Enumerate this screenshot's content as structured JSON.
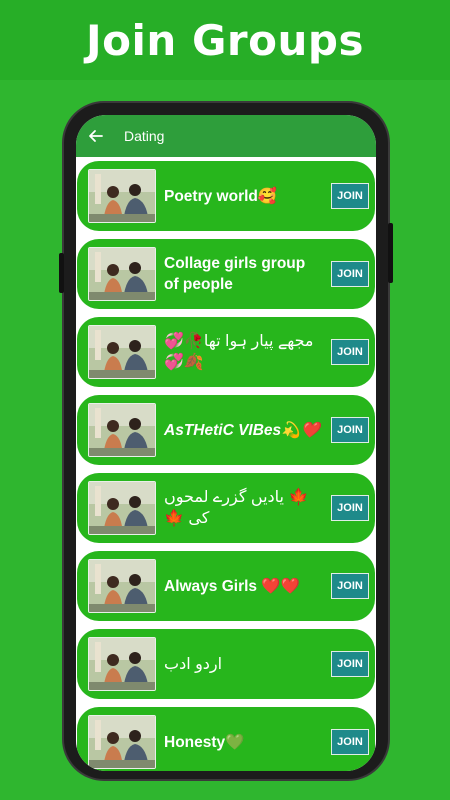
{
  "banner": {
    "title": "Join Groups"
  },
  "appbar": {
    "title": "Dating",
    "back_icon": "arrow-left-icon"
  },
  "colors": {
    "background": "#2fb62f",
    "card": "#27b61c",
    "appbar": "#2e9e3b",
    "join_button": "#1e8a8a"
  },
  "groups": [
    {
      "name": "Poetry world🥰",
      "join_label": "JOIN"
    },
    {
      "name": "Collage girls group of people",
      "join_label": "JOIN"
    },
    {
      "name": "مجھے پیار ہوا تھا🥀💞🍂💞",
      "join_label": "JOIN"
    },
    {
      "name": "AsTHetiC VIBes💫❤️",
      "join_label": "JOIN"
    },
    {
      "name": "🍁 یادیں گزرے لمحوں کی 🍁",
      "join_label": "JOIN"
    },
    {
      "name": "Always Girls ❤️❤️",
      "join_label": "JOIN"
    },
    {
      "name": "اردو ادب",
      "join_label": "JOIN"
    },
    {
      "name": "Honesty💚",
      "join_label": "JOIN"
    }
  ]
}
